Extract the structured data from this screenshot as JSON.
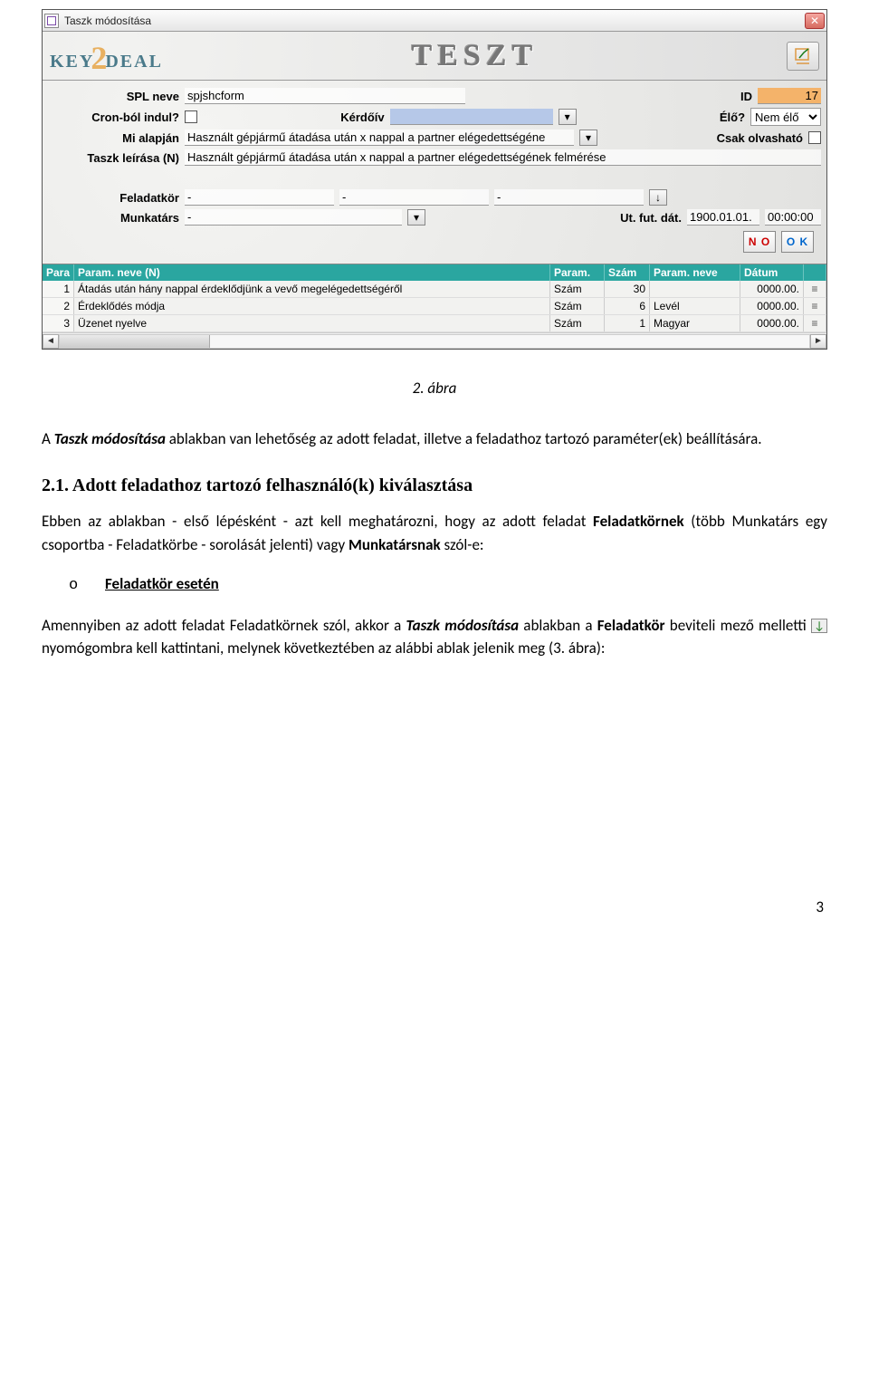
{
  "window": {
    "title": "Taszk módosítása"
  },
  "banner": {
    "logo_left": "KEY",
    "logo_right": "DEAL",
    "center": "TESZT"
  },
  "fields": {
    "spl_neve_label": "SPL neve",
    "spl_neve_value": "spjshcform",
    "id_label": "ID",
    "id_value": "17",
    "cron_label": "Cron-ból indul?",
    "kerdoiv_label": "Kérdőív",
    "kerdoiv_value": "",
    "elo_label": "Élő?",
    "elo_value": "Nem élő",
    "mi_alapjan_label": "Mi alapján",
    "mi_alapjan_value": "Használt gépjármű átadása után x nappal a partner elégedettségéne",
    "csak_olvashato_label": "Csak olvasható",
    "taszk_leirasa_label": "Taszk leírása (N)",
    "taszk_leirasa_value": "Használt gépjármű átadása után x nappal a partner elégedettségének felmérése",
    "feladatkor_label": "Feladatkör",
    "feladatkor_value": "-",
    "feladatkor_value2": "-",
    "feladatkor_value3": "-",
    "munkatars_label": "Munkatárs",
    "munkatars_value": "-",
    "utfutdat_label": "Ut. fut. dát.",
    "utfutdat_date": "1900.01.01.",
    "utfutdat_time": "00:00:00"
  },
  "actions": {
    "no_label": "N O",
    "ok_label": "O K"
  },
  "grid": {
    "headers": {
      "para": "Para",
      "paramneve": "Param. neve (N)",
      "param_type": "Param.",
      "szam": "Szám",
      "paramneve2": "Param. neve",
      "datum": "Dátum"
    },
    "rows": [
      {
        "n": "1",
        "name": "Átadás után hány nappal érdeklődjünk a vevő megelégedettségéről",
        "type": "Szám",
        "num": "30",
        "name2": "",
        "date": "0000.00."
      },
      {
        "n": "2",
        "name": "Érdeklődés módja",
        "type": "Szám",
        "num": "6",
        "name2": "Levél",
        "date": "0000.00."
      },
      {
        "n": "3",
        "name": "Üzenet nyelve",
        "type": "Szám",
        "num": "1",
        "name2": "Magyar",
        "date": "0000.00."
      }
    ]
  },
  "doc": {
    "caption": "2. ábra",
    "p1a": "A ",
    "p1b": "Taszk módosítása",
    "p1c": " ablakban van lehetőség az adott feladat, illetve a feladathoz tartozó paraméter(ek) beállítására.",
    "heading": "2.1. Adott feladathoz tartozó felhasználó(k) kiválasztása",
    "p2a": "Ebben az ablakban - első lépésként - azt kell meghatározni, hogy az adott feladat ",
    "p2b": "Feladatkörnek",
    "p2c": " (több Munkatárs egy csoportba - Feladatkörbe - sorolását jelenti) vagy ",
    "p2d": "Munkatársnak",
    "p2e": " szól-e:",
    "bullet": "Feladatkör esetén",
    "p3a": "Amennyiben az adott feladat Feladatkörnek szól, akkor a ",
    "p3b": "Taszk módosítása",
    "p3c": " ablakban a ",
    "p3d": "Feladatkör",
    "p3e": " beviteli mező melletti ",
    "p3f": " nyomógombra kell kattintani, melynek következtében az alábbi ablak jelenik meg (3. ábra):",
    "pagenum": "3"
  }
}
